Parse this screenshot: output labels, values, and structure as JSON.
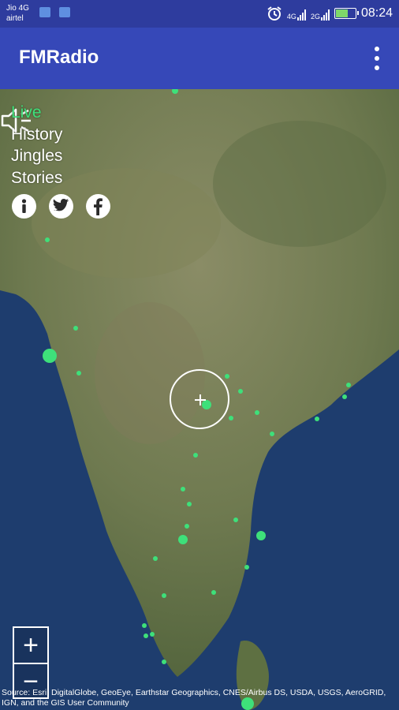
{
  "status_bar": {
    "carrier_line1": "Jio 4G",
    "carrier_line2": "airtel",
    "network1": "4G",
    "network2": "2G",
    "time": "08:24",
    "battery_percent": 70,
    "icons": [
      "app-notification-icon",
      "app-notification-icon",
      "alarm-icon",
      "signal-icon",
      "signal-icon",
      "battery-icon"
    ]
  },
  "app_bar": {
    "title": "FMRadio",
    "overflow_icon": "more-vert-icon"
  },
  "menu": {
    "items": [
      {
        "label": "Live",
        "active": true
      },
      {
        "label": "History",
        "active": false
      },
      {
        "label": "Jingles",
        "active": false
      },
      {
        "label": "Stories",
        "active": false
      }
    ],
    "social_icons": [
      "info-icon",
      "twitter-icon",
      "facebook-icon"
    ]
  },
  "map": {
    "speaker_icon": "volume-icon",
    "crosshair_icon": "crosshair-icon",
    "zoom_in": "+",
    "zoom_out": "−",
    "attribution": "Source: Esri, DigitalGlobe, GeoEye, Earthstar Geographics, CNES/Airbus DS, USDA, USGS, AeroGRID, IGN, and the GIS User Community",
    "station_color": "#3ee07a",
    "land_color": "#6e7a52",
    "ocean_color": "#1e3d6e"
  }
}
